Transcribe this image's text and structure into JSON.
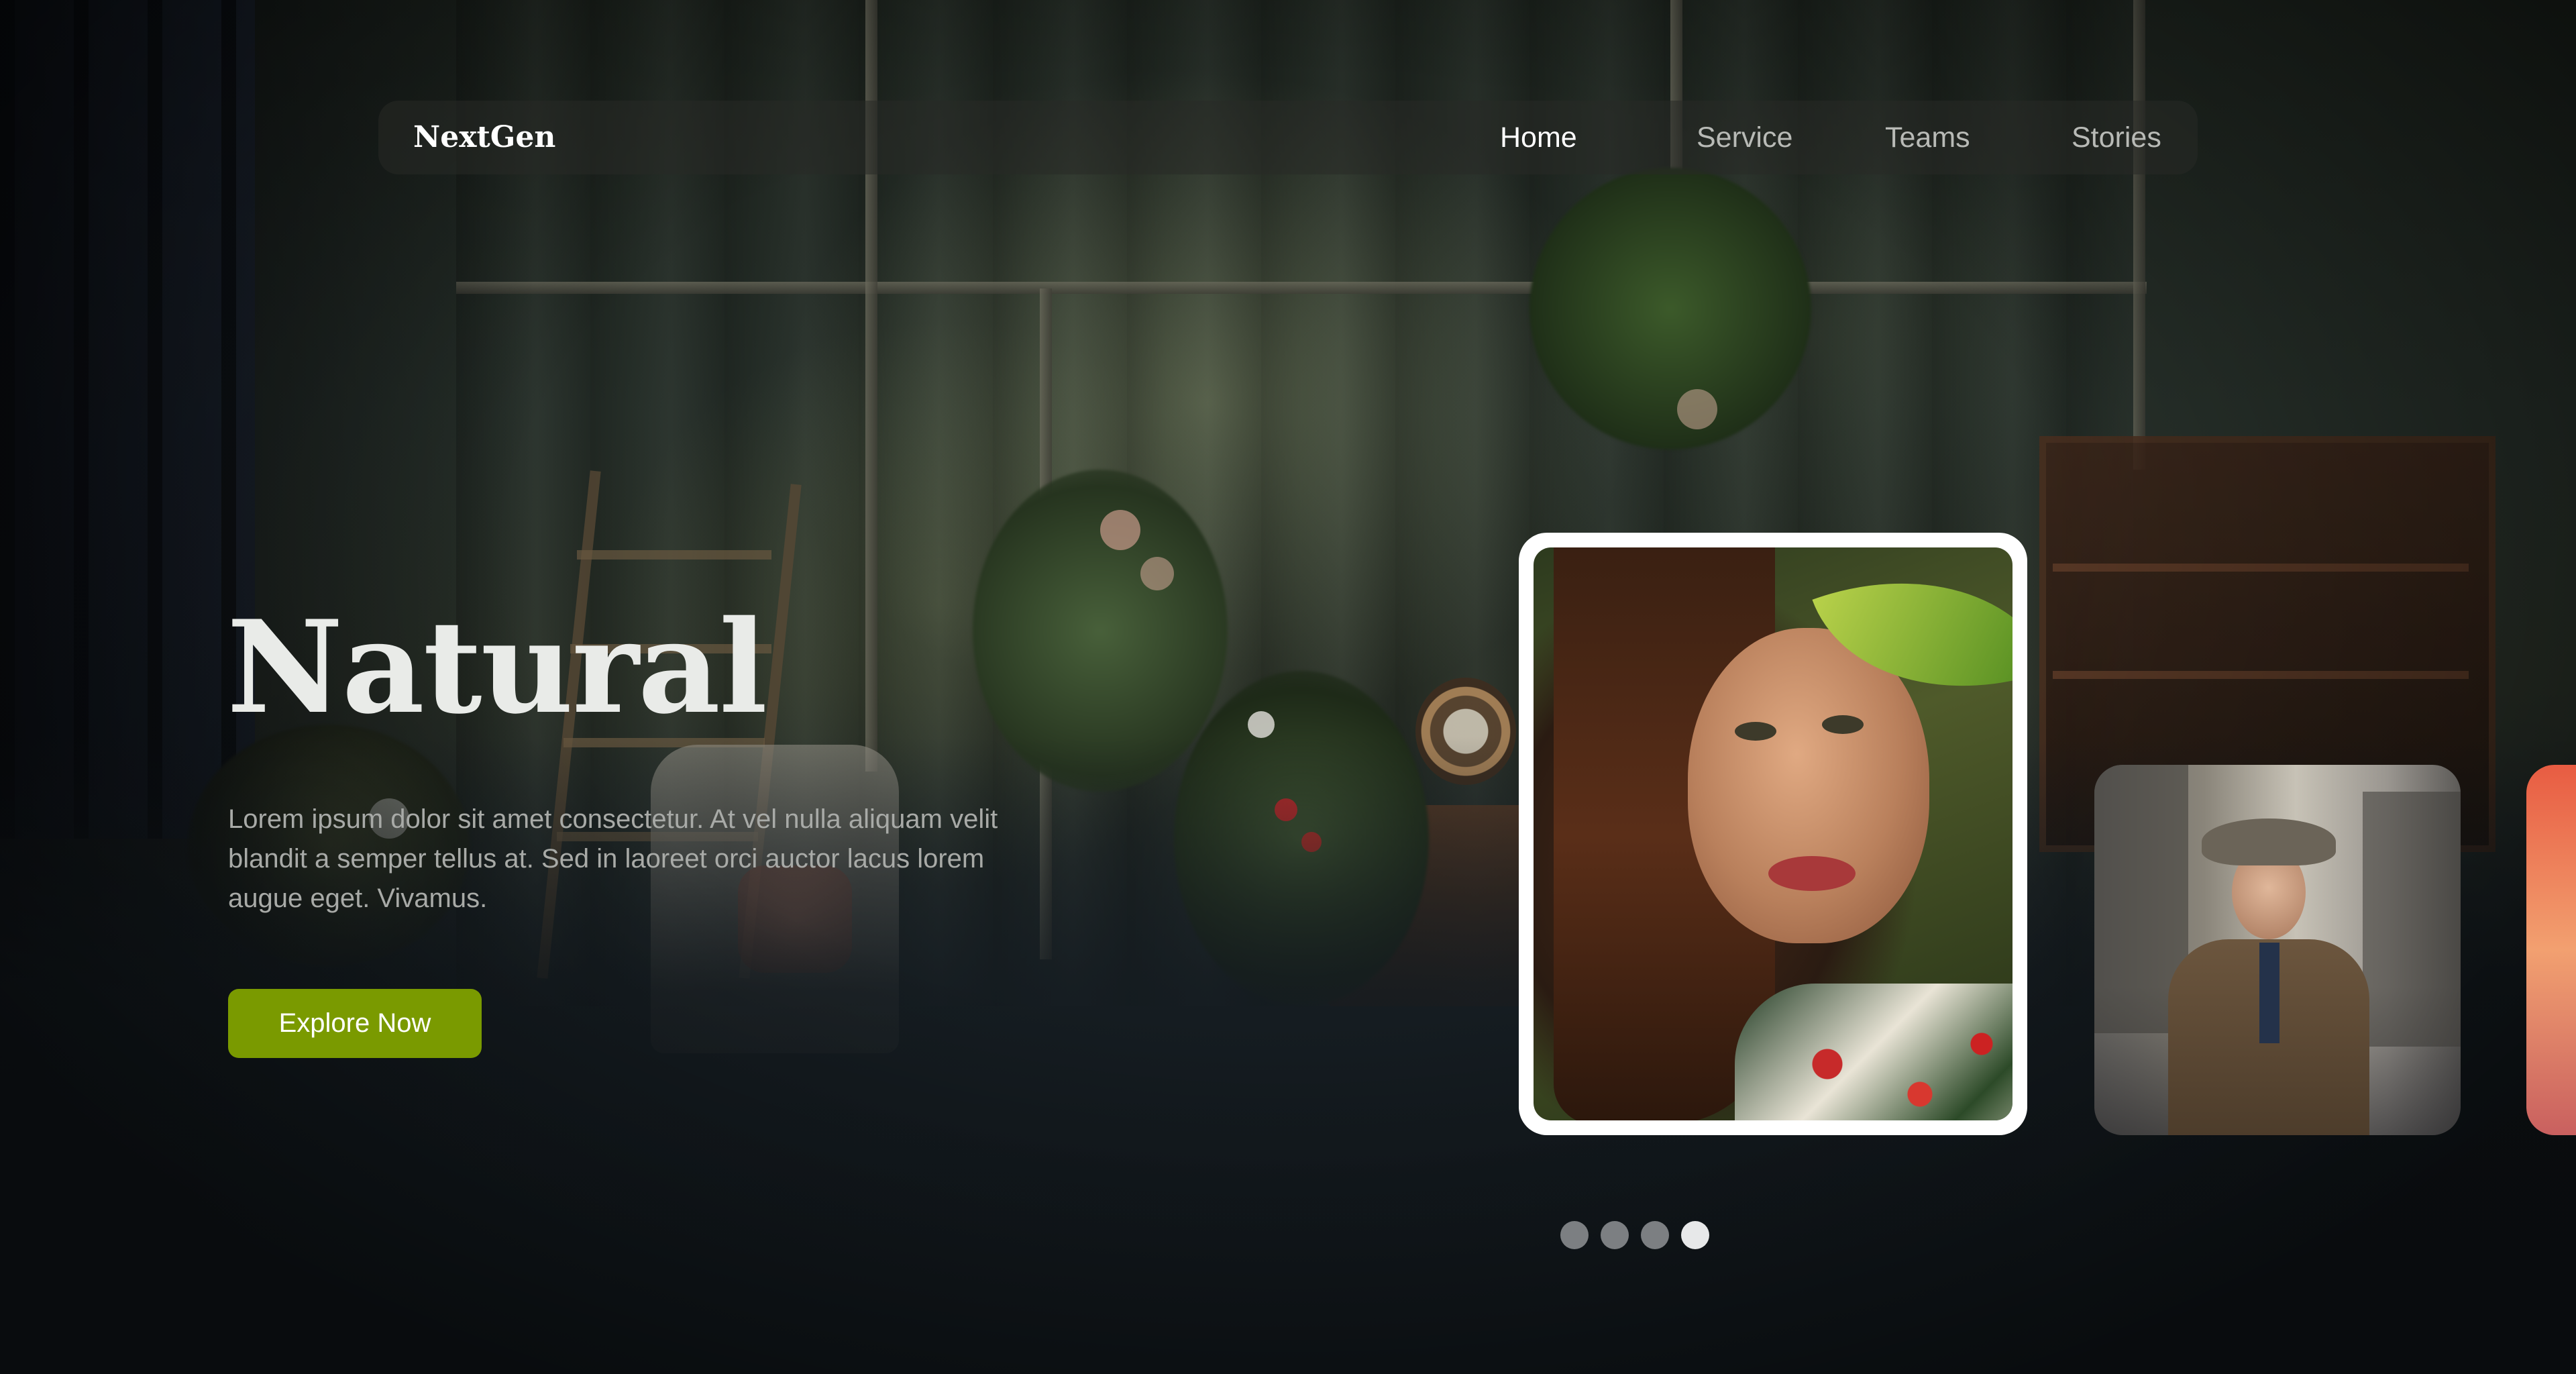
{
  "brand": {
    "name": "NextGen"
  },
  "nav": {
    "items": [
      {
        "label": "Home",
        "active": true
      },
      {
        "label": "Service",
        "active": false
      },
      {
        "label": "Teams",
        "active": false
      },
      {
        "label": "Stories",
        "active": false
      }
    ]
  },
  "hero": {
    "title": "Natural",
    "description": "Lorem ipsum dolor sit amet consectetur. At vel nulla aliquam velit blandit a semper tellus at. Sed in laoreet orci auctor lacus lorem augue eget. Vivamus.",
    "cta_label": "Explore Now"
  },
  "carousel": {
    "cards": [
      {
        "subject": "woman-portrait",
        "selected": true
      },
      {
        "subject": "elderly-man-street",
        "selected": false
      },
      {
        "subject": "sunset-partial",
        "selected": false
      }
    ],
    "total_slides": 4,
    "active_slide": 4
  },
  "colors": {
    "accent": "#7a9a00",
    "nav_active": "#ffffff",
    "nav_inactive": "#b8bab6",
    "dot_active": "#e7e8e9",
    "dot_inactive": "#7c7f82"
  },
  "icons": {
    "brand": "text-logo",
    "pagination": "dot"
  }
}
